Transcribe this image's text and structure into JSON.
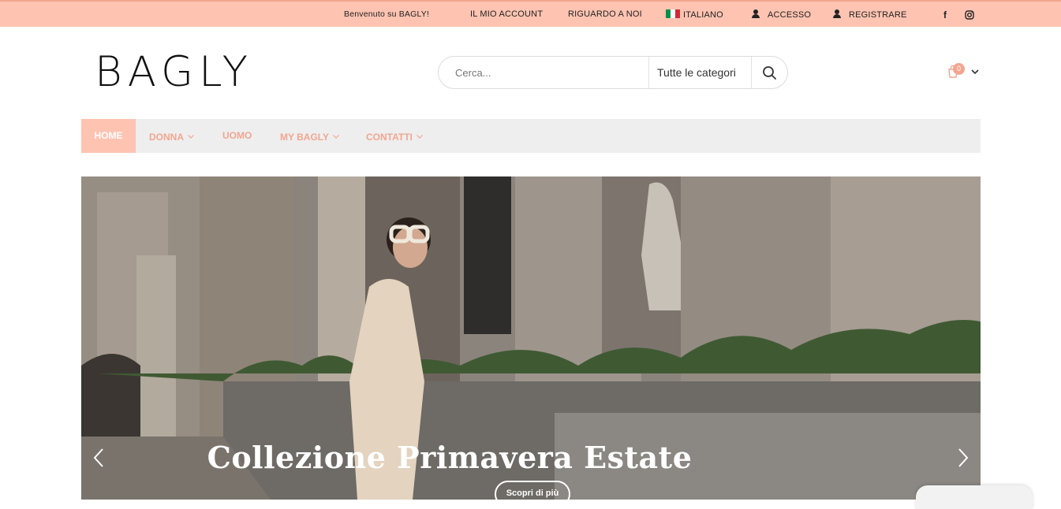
{
  "topbar": {
    "welcome": "Benvenuto su BAGLY!",
    "account": "IL MIO ACCOUNT",
    "about": "RIGUARDO A NOI",
    "language": "ITALIANO",
    "login": "ACCESSO",
    "register": "REGISTRARE",
    "social": [
      "facebook-icon",
      "instagram-icon"
    ],
    "bg_color": "#fec3b1"
  },
  "header": {
    "logo": "BAGLY",
    "search_placeholder": "Cerca...",
    "category": "Tutte le categori",
    "cart_count": "0"
  },
  "nav": {
    "items": [
      "HOME",
      "DONNA",
      "UOMO",
      "MY BAGLY",
      "CONTATTI"
    ],
    "accent": "#f3a590"
  },
  "slider": {
    "headline": "Collezione Primavera Estate",
    "cta": "Scopri di più"
  }
}
